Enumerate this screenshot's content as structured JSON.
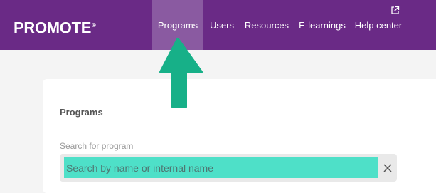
{
  "header": {
    "logo_text": "PROMOTE",
    "logo_mark": "®",
    "nav": [
      {
        "label": "Programs",
        "active": true
      },
      {
        "label": "Users",
        "active": false
      },
      {
        "label": "Resources",
        "active": false
      },
      {
        "label": "E-learnings",
        "active": false
      },
      {
        "label": "Help center",
        "active": false
      }
    ],
    "external_link_icon": "external-link-icon"
  },
  "main": {
    "card_title": "Programs",
    "search": {
      "label": "Search for program",
      "placeholder": "Search by name or internal name",
      "value": "",
      "clear_icon": "close-icon"
    }
  },
  "annotation": {
    "arrow_icon": "arrow-up-icon",
    "arrow_color": "#17b088"
  },
  "colors": {
    "header_bg": "#6a2a86",
    "active_tab_bg": "#8a5aa1",
    "search_highlight": "#4ee0c8",
    "page_bg": "#f4f4f4"
  }
}
